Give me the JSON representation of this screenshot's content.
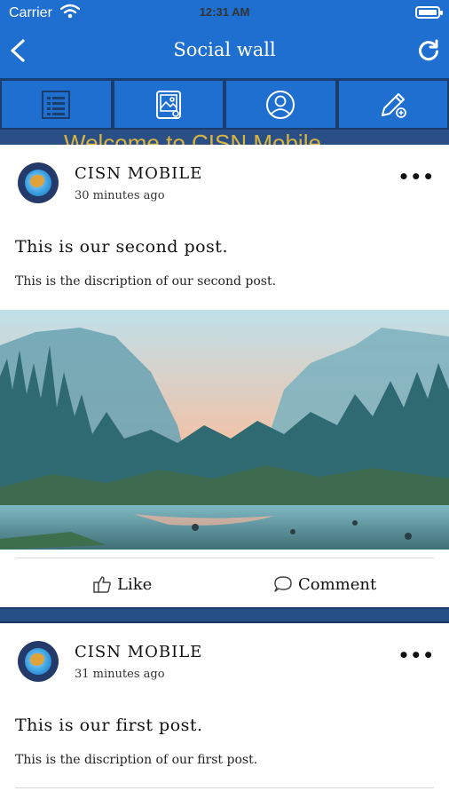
{
  "status_bar": {
    "carrier": "Carrier",
    "time": "12:31 AM"
  },
  "nav": {
    "title": "Social wall",
    "back_icon": "chevron-left-icon",
    "refresh_icon": "refresh-icon"
  },
  "tabs": [
    {
      "name": "feed-list",
      "icon": "list-icon"
    },
    {
      "name": "photos",
      "icon": "image-icon"
    },
    {
      "name": "profile",
      "icon": "user-icon"
    },
    {
      "name": "create-post",
      "icon": "edit-icon"
    }
  ],
  "marquee": {
    "text": "Welcome to CISN Mobile"
  },
  "posts": [
    {
      "author": "CISN MOBILE",
      "time": "30 minutes ago",
      "title": "This is our second post.",
      "description": "This is the discription of our second post.",
      "has_image": true,
      "like_label": "Like",
      "comment_label": "Comment"
    },
    {
      "author": "CISN MOBILE",
      "time": "31 minutes ago",
      "title": "This is our first post.",
      "description": "This is the discription of our first post."
    }
  ],
  "more_symbol": "•••",
  "colors": {
    "primary": "#1f6fd1",
    "tab_border": "#1a3d6b",
    "marquee_bg": "#2a4f86",
    "marquee_text": "#d9b43f"
  }
}
